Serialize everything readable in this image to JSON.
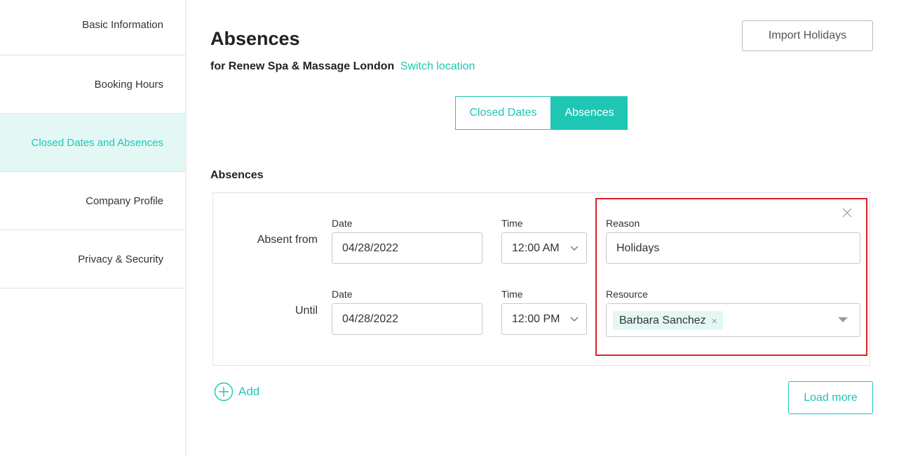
{
  "sidebar": {
    "items": [
      {
        "label": "Basic Information"
      },
      {
        "label": "Booking Hours"
      },
      {
        "label": "Closed Dates and Absences"
      },
      {
        "label": "Company Profile"
      },
      {
        "label": "Privacy & Security"
      }
    ]
  },
  "header": {
    "title": "Absences",
    "subtitle_prefix": "for Renew Spa & Massage London",
    "switch_location": "Switch location",
    "import_button": "Import Holidays"
  },
  "tabs": {
    "closed_dates": "Closed Dates",
    "absences": "Absences"
  },
  "section": {
    "title": "Absences"
  },
  "form": {
    "from": {
      "label": "Absent from",
      "date_label": "Date",
      "date_value": "04/28/2022",
      "time_label": "Time",
      "time_value": "12:00 AM"
    },
    "until": {
      "label": "Until",
      "date_label": "Date",
      "date_value": "04/28/2022",
      "time_label": "Time",
      "time_value": "12:00 PM"
    },
    "reason": {
      "label": "Reason",
      "value": "Holidays"
    },
    "resource": {
      "label": "Resource",
      "tag": "Barbara Sanchez",
      "tag_remove": "×"
    }
  },
  "actions": {
    "add": "Add",
    "load_more": "Load more"
  },
  "colors": {
    "accent": "#1fc6b4",
    "accent_light": "#e3f8f5",
    "highlight": "#d9222a"
  }
}
